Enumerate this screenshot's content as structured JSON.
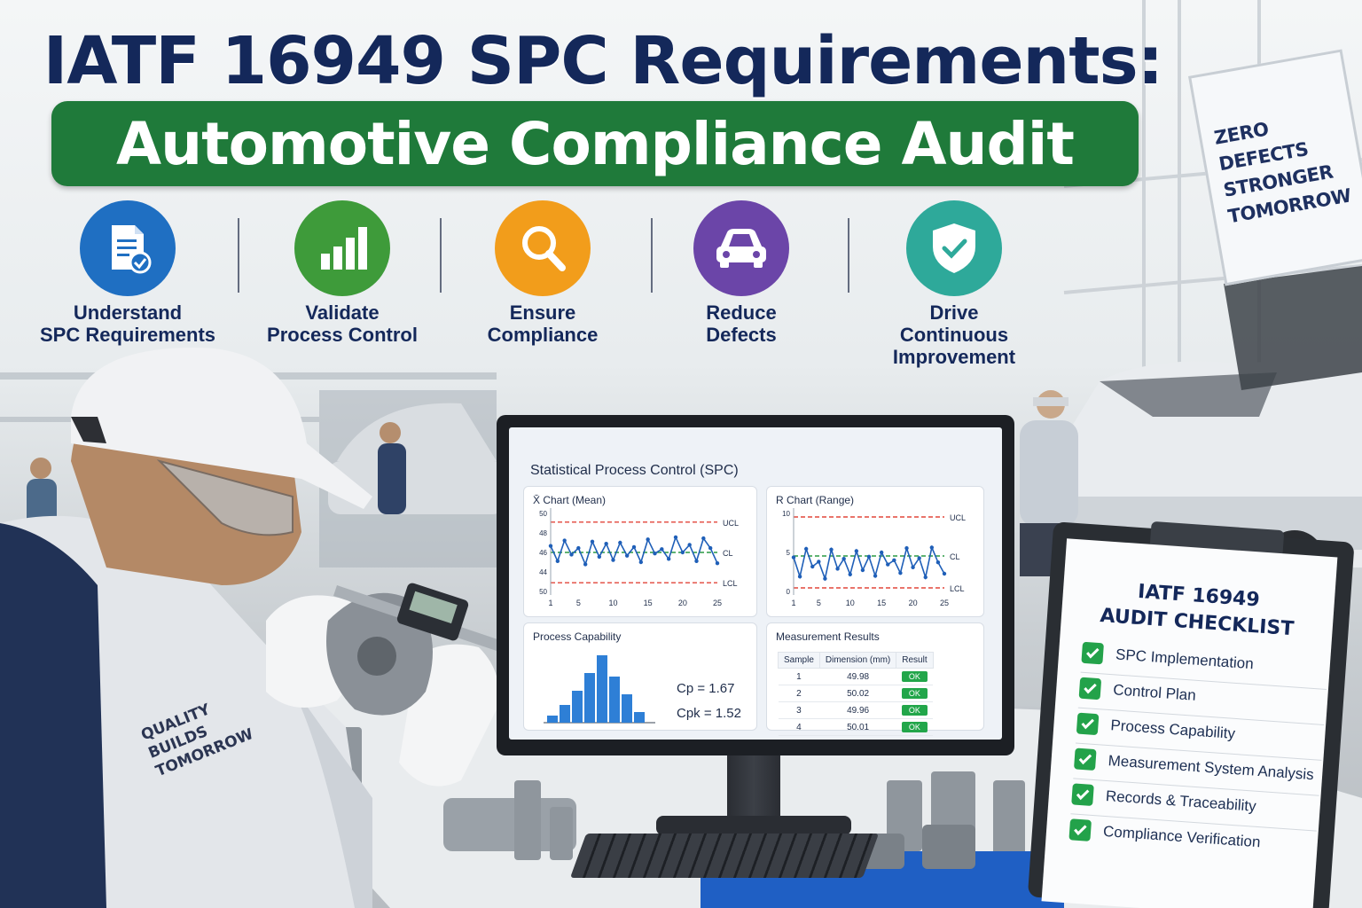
{
  "headline": {
    "title": "IATF 16949 SPC Requirements:",
    "subtitle": "Automotive Compliance Audit"
  },
  "benefits": [
    {
      "label": "Understand\nSPC Requirements",
      "icon": "document-check-icon",
      "color": "#1f6fc2"
    },
    {
      "label": "Validate\nProcess Control",
      "icon": "bar-chart-icon",
      "color": "#3e9b3a"
    },
    {
      "label": "Ensure\nCompliance",
      "icon": "magnifier-icon",
      "color": "#f29d1b"
    },
    {
      "label": "Reduce\nDefects",
      "icon": "car-icon",
      "color": "#6b45a8"
    },
    {
      "label": "Drive\nContinuous\nImprovement",
      "icon": "shield-check-icon",
      "color": "#2ea99a"
    }
  ],
  "sign": {
    "line1": "ZERO DEFECTS",
    "line2": "STRONGER",
    "line3": "TOMORROW"
  },
  "worker": {
    "line1": "QUALITY",
    "line2": "BUILDS",
    "line3": "TOMORROW"
  },
  "screen": {
    "title": "Statistical Process Control (SPC)",
    "xbar": {
      "title": "X̄ Chart (Mean)",
      "ucl_label": "UCL",
      "cl_label": "CL",
      "lcl_label": "LCL",
      "y_ticks": [
        "50",
        "48",
        "46",
        "44",
        "50"
      ],
      "x_ticks": [
        "1",
        "5",
        "10",
        "15",
        "20",
        "25"
      ]
    },
    "range": {
      "title": "R Chart (Range)",
      "ucl_label": "UCL",
      "cl_label": "CL",
      "lcl_label": "LCL",
      "y_ticks": [
        "10",
        "5",
        "0"
      ],
      "x_ticks": [
        "1",
        "5",
        "10",
        "15",
        "20",
        "25"
      ]
    },
    "capability": {
      "title": "Process Capability",
      "cp": "Cp = 1.67",
      "cpk": "Cpk = 1.52"
    },
    "measurements": {
      "title": "Measurement Results",
      "headers": [
        "Sample",
        "Dimension (mm)",
        "Result"
      ],
      "rows": [
        {
          "sample": "1",
          "dimension": "49.98",
          "result": "OK"
        },
        {
          "sample": "2",
          "dimension": "50.02",
          "result": "OK"
        },
        {
          "sample": "3",
          "dimension": "49.96",
          "result": "OK"
        },
        {
          "sample": "4",
          "dimension": "50.01",
          "result": "OK"
        }
      ]
    }
  },
  "checklist": {
    "title_line1": "IATF 16949",
    "title_line2": "AUDIT CHECKLIST",
    "items": [
      "SPC Implementation",
      "Control Plan",
      "Process Capability",
      "Measurement System Analysis",
      "Records & Traceability",
      "Compliance Verification"
    ]
  },
  "chart_data": [
    {
      "type": "line",
      "title": "X̄ Chart (Mean)",
      "x": [
        1,
        2,
        3,
        4,
        5,
        6,
        7,
        8,
        9,
        10,
        11,
        12,
        13,
        14,
        15,
        16,
        17,
        18,
        19,
        20,
        21,
        22,
        23,
        24,
        25
      ],
      "series": [
        {
          "values": [
            46.6,
            45.2,
            47.1,
            45.8,
            46.4,
            44.9,
            47.0,
            45.6,
            46.8,
            45.3,
            46.9,
            45.7,
            46.5,
            45.1,
            47.2,
            45.9,
            46.3,
            45.4,
            47.4,
            46.0,
            46.7,
            45.2,
            47.3,
            46.4,
            45.0
          ]
        }
      ],
      "ucl": 48.8,
      "cl": 46.0,
      "lcl": 43.2
    },
    {
      "type": "line",
      "title": "R Chart (Range)",
      "x": [
        1,
        2,
        3,
        4,
        5,
        6,
        7,
        8,
        9,
        10,
        11,
        12,
        13,
        14,
        15,
        16,
        17,
        18,
        19,
        20,
        21,
        22,
        23,
        24,
        25
      ],
      "series": [
        {
          "values": [
            4.8,
            2.1,
            6.0,
            3.5,
            4.2,
            1.8,
            5.9,
            3.2,
            4.6,
            2.4,
            5.7,
            3.0,
            4.9,
            2.2,
            5.5,
            3.8,
            4.4,
            2.6,
            6.1,
            3.4,
            4.7,
            2.0,
            6.2,
            4.1,
            2.5
          ]
        }
      ],
      "ucl": 10.5,
      "cl": 5.0,
      "lcl": 0.5,
      "ylim": [
        0,
        10
      ]
    },
    {
      "type": "bar",
      "title": "Process Capability",
      "values": [
        2,
        5,
        9,
        14,
        19,
        13,
        8,
        3
      ]
    }
  ]
}
